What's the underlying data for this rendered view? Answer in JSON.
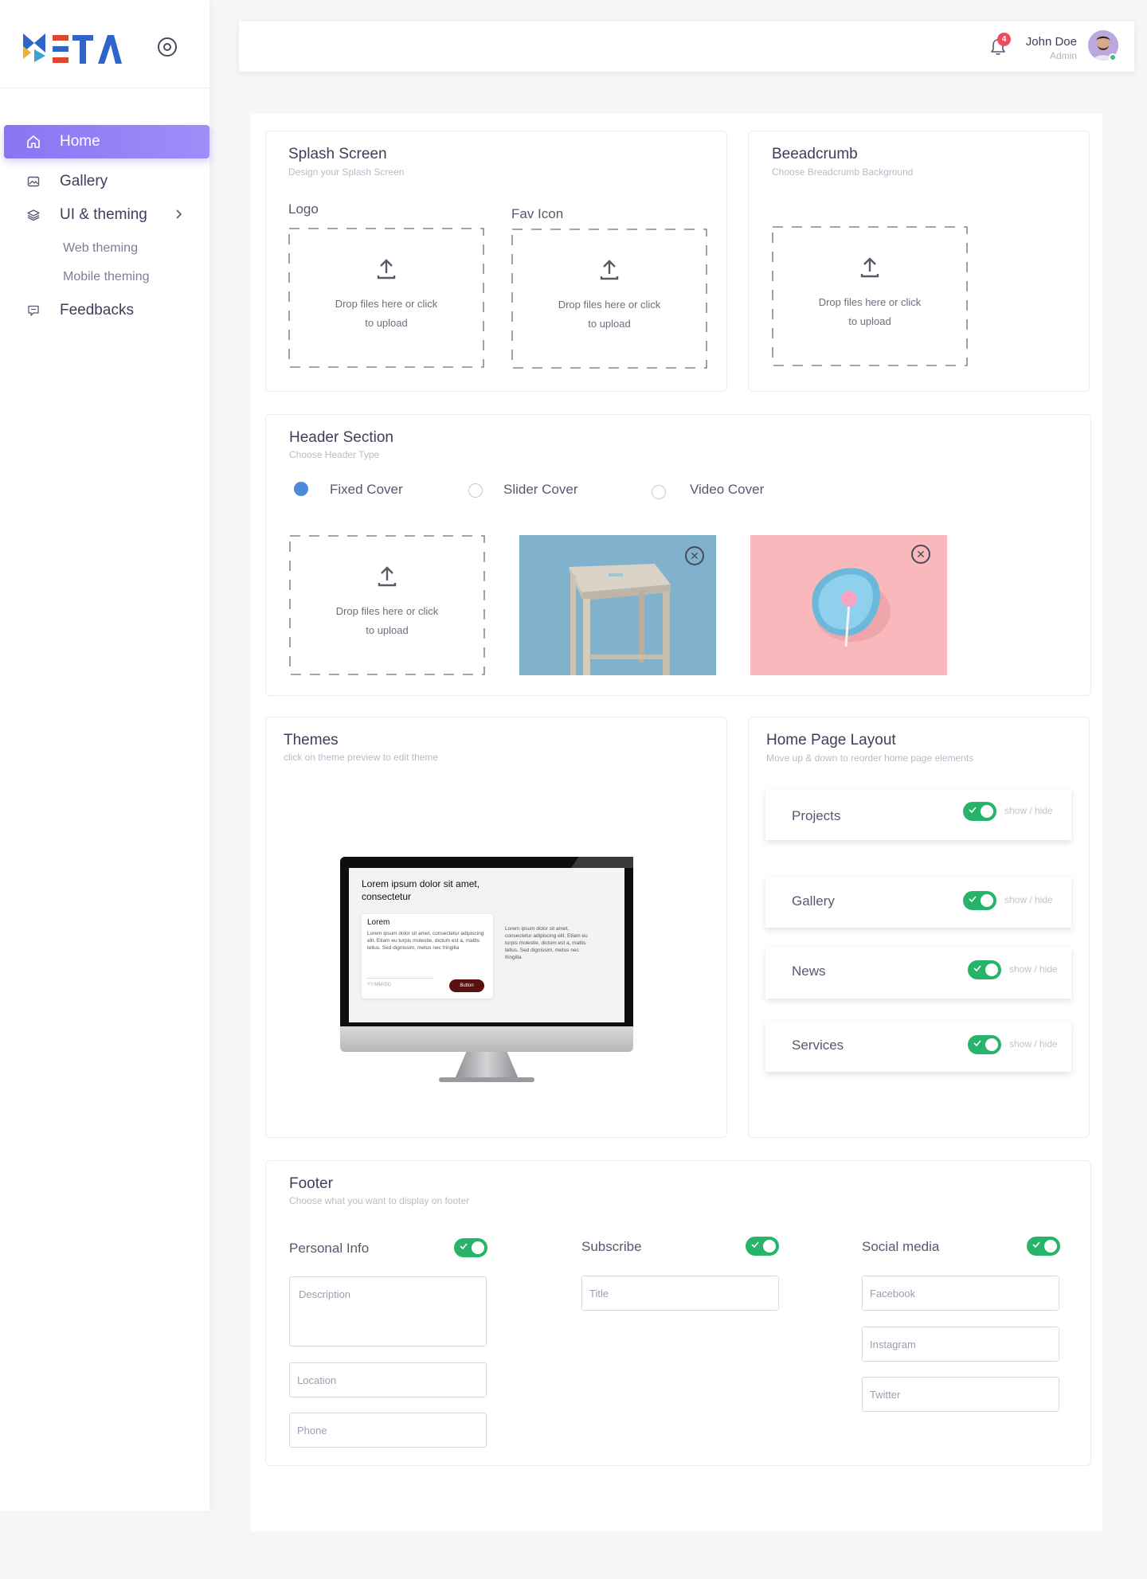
{
  "brand": {
    "logo_text": "META"
  },
  "sidebar": {
    "items": [
      {
        "label": "Home"
      },
      {
        "label": "Gallery"
      },
      {
        "label": "UI & theming"
      },
      {
        "label": "Feedbacks"
      }
    ],
    "sub_items": [
      {
        "label": "Web theming"
      },
      {
        "label": "Mobile theming"
      }
    ]
  },
  "topbar": {
    "notification_count": "4",
    "user_name": "John Doe",
    "user_role": "Admin"
  },
  "splash": {
    "title": "Splash Screen",
    "subtitle": "Design your Splash Screen",
    "logo_label": "Logo",
    "favicon_label": "Fav Icon"
  },
  "breadcrumb": {
    "title": "Beeadcrumb",
    "subtitle": "Choose Breadcrumb Background"
  },
  "dropzone": {
    "line1": "Drop files here or click",
    "line2": "to upload"
  },
  "header_section": {
    "title": "Header Section",
    "subtitle": "Choose Header Type",
    "options": [
      {
        "label": "Fixed Cover",
        "selected": true
      },
      {
        "label": "Slider Cover",
        "selected": false
      },
      {
        "label": "Video Cover",
        "selected": false
      }
    ]
  },
  "themes": {
    "title": "Themes",
    "subtitle": "click on theme preview to edit theme",
    "preview": {
      "heading": "Lorem ipsum dolor sit amet, consectetur",
      "card_title": "Lorem",
      "card_text": "Lorem ipsum dolor sit amet, consectetur adipiscing elit. Etiam eu turpis molestie, dictum est a, mattis tellus. Sed dignissim, metus nec fringilla",
      "date_placeholder": "YY/MM/DD",
      "button": "Button",
      "side_text": "Lorem ipsum dolor sit amet, consectetur adipiscing elit. Etiam eu turpis molestie, dictum est a, mattis tellus. Sed dignissim, metus nec fringilla"
    }
  },
  "home_layout": {
    "title": "Home Page Layout",
    "subtitle": "Move up & down to reorder home page elements",
    "toggle_label": "show / hide",
    "items": [
      {
        "label": "Projects",
        "on": true
      },
      {
        "label": "Gallery",
        "on": true
      },
      {
        "label": "News",
        "on": true
      },
      {
        "label": "Services",
        "on": true
      }
    ]
  },
  "footer": {
    "title": "Footer",
    "subtitle": "Choose what you want to display on footer",
    "groups": [
      {
        "label": "Personal Info",
        "on": true,
        "fields": [
          "Description",
          "Location",
          "Phone"
        ]
      },
      {
        "label": "Subscribe",
        "on": true,
        "fields": [
          "Title"
        ]
      },
      {
        "label": "Social media",
        "on": true,
        "fields": [
          "Facebook",
          "Instagram",
          "Twitter"
        ]
      }
    ]
  },
  "colors": {
    "accent": "#8b74f3",
    "toggle_on": "#27b36a",
    "radio_on": "#4d8ad8",
    "badge": "#ef4b5e"
  }
}
